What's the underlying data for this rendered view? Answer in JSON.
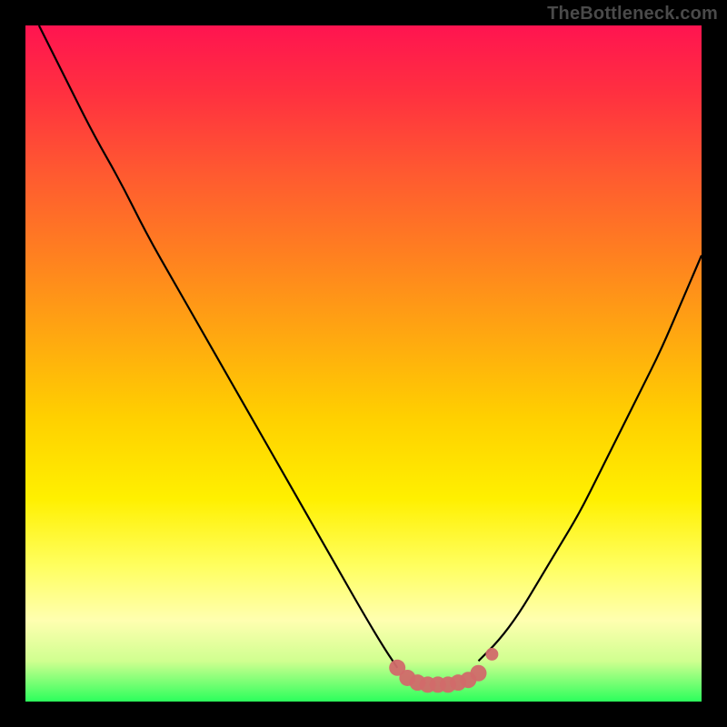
{
  "watermark": "TheBottleneck.com",
  "colors": {
    "frame": "#000000",
    "line": "#000000",
    "marker_stroke": "#d16a6a",
    "marker_fill": "#d16a6a",
    "gradient_top": "#ff1450",
    "gradient_bottom": "#2cff5c"
  },
  "chart_data": {
    "type": "line",
    "title": "",
    "xlabel": "",
    "ylabel": "",
    "xlim": [
      0,
      100
    ],
    "ylim": [
      0,
      100
    ],
    "series": [
      {
        "name": "left-curve",
        "x": [
          2,
          6,
          10,
          14,
          18,
          22,
          26,
          30,
          34,
          38,
          42,
          46,
          50,
          53,
          55
        ],
        "y": [
          100,
          92,
          84,
          77,
          69,
          62,
          55,
          48,
          41,
          34,
          27,
          20,
          13,
          8,
          5
        ]
      },
      {
        "name": "right-curve",
        "x": [
          67,
          70,
          73,
          76,
          79,
          82,
          85,
          88,
          91,
          94,
          97,
          100
        ],
        "y": [
          6,
          9,
          13,
          18,
          23,
          28,
          34,
          40,
          46,
          52,
          59,
          66
        ]
      },
      {
        "name": "bottom-markers",
        "x": [
          55,
          56.5,
          58,
          59.5,
          61,
          62.5,
          64,
          65.5,
          67,
          69
        ],
        "y": [
          5,
          3.5,
          2.8,
          2.5,
          2.5,
          2.5,
          2.8,
          3.2,
          4.2,
          7
        ]
      }
    ],
    "annotations": []
  }
}
